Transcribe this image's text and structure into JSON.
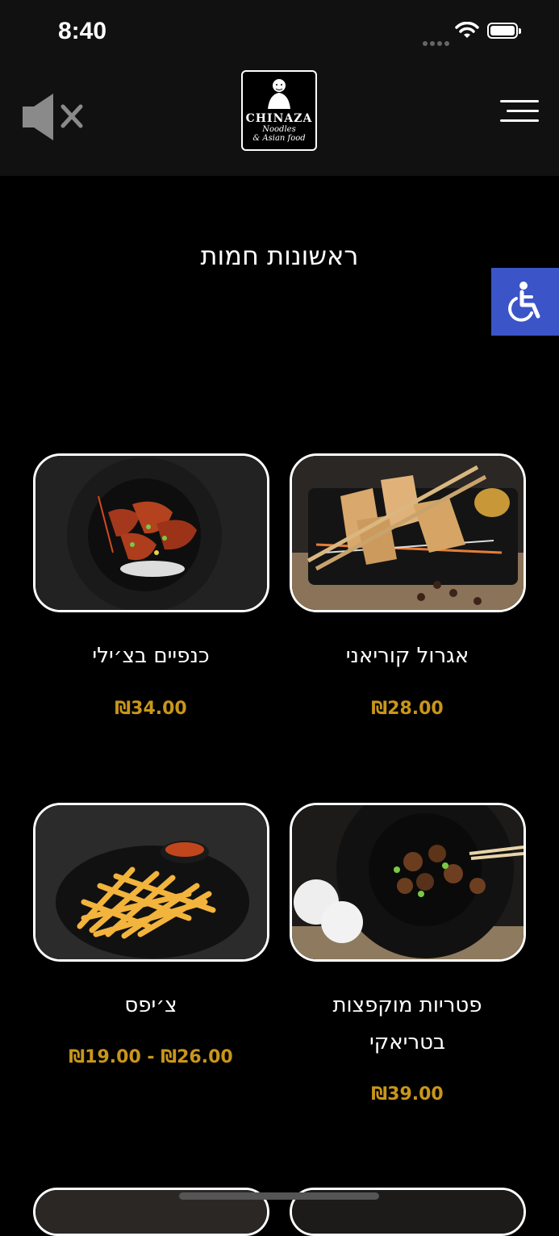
{
  "status_bar": {
    "time": "8:40"
  },
  "header": {
    "logo": {
      "brand": "CHINAZA",
      "tagline_1": "Noodles",
      "tagline_2": "& Asian food"
    }
  },
  "page": {
    "title": "ראשונות חמות"
  },
  "products": [
    {
      "name": "אגרול קוריאני",
      "price": "₪28.00"
    },
    {
      "name": "כנפיים בצ׳ילי",
      "price": "₪34.00"
    },
    {
      "name_line_1": "פטריות מוקפצות",
      "name_line_2": "בטריאקי",
      "price": "₪39.00"
    },
    {
      "name": "צ׳יפס",
      "price_low": "₪19.00",
      "price_sep": "-",
      "price_high": "₪26.00"
    }
  ],
  "colors": {
    "price": "#c9961a",
    "accessibility_button": "#3b54c8",
    "header_bg": "#111111",
    "page_bg": "#000000"
  },
  "icons": [
    "mute-icon",
    "hamburger-menu-icon",
    "accessibility-icon",
    "wifi-icon",
    "battery-icon"
  ]
}
